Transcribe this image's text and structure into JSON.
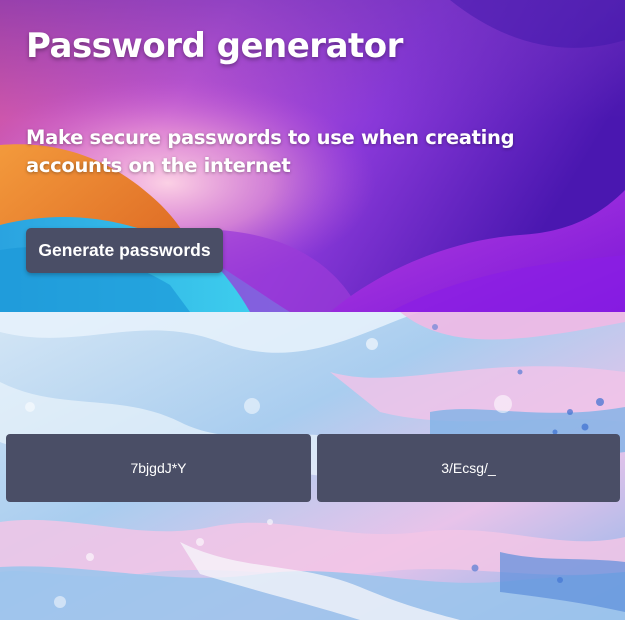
{
  "hero": {
    "title": "Password generator",
    "subtitle": "Make secure passwords to use when creating accounts on the internet",
    "generate_button_label": "Generate passwords"
  },
  "passwords": [
    {
      "value": "7bjgdJ*Y"
    },
    {
      "value": "3/Ecsg/_"
    }
  ],
  "colors": {
    "button_bg": "#4a4e66",
    "text": "#ffffff",
    "hero_purple": "#6a1fc8",
    "hero_orange": "#e9782a",
    "hero_cyan": "#2bb7ea",
    "marble_blue": "#9cc4ec",
    "marble_pink": "#efb6e0"
  }
}
